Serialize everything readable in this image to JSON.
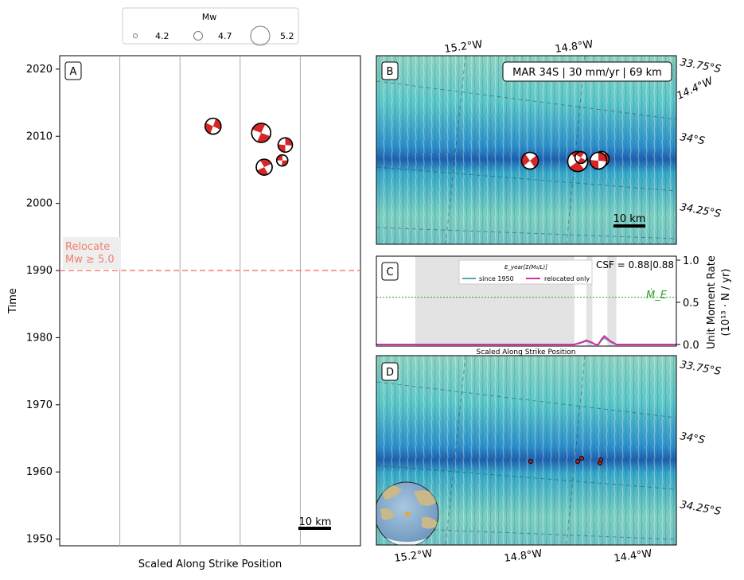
{
  "legend": {
    "title": "Mw",
    "entries": [
      {
        "label": "4.2",
        "value": 4.2
      },
      {
        "label": "4.7",
        "value": 4.7
      },
      {
        "label": "5.2",
        "value": 5.2
      }
    ]
  },
  "panelA": {
    "tag": "A",
    "xlabel": "Scaled Along Strike Position",
    "ylabel": "Time",
    "yticks": [
      "1950",
      "1960",
      "1970",
      "1980",
      "1990",
      "2000",
      "2010",
      "2020"
    ],
    "relocate_label": "Relocate",
    "relocate_mw": "Mw ≥ 5.0",
    "scalebar": "10 km"
  },
  "panelB": {
    "tag": "B",
    "info": "MAR 34S | 30 mm/yr | 69 km",
    "top_lon_labels": [
      "15.2°W",
      "14.8°W"
    ],
    "right_labels": [
      "33.75°S",
      "14.4°W",
      "34°S",
      "34.25°S"
    ],
    "scalebar": "10 km"
  },
  "panelC": {
    "tag": "C",
    "csf": "CSF = 0.88|0.88",
    "legend_title": "E_year[Σ(M₀/L)]",
    "series": [
      "since 1950",
      "relocated only"
    ],
    "xlabel": "Scaled Along Strike Position",
    "ylabel": "Unit Moment Rate",
    "ylabel_units": "(10¹³ · N / yr)",
    "yticks": [
      "0.0",
      "0.5",
      "1.0"
    ],
    "me_label": "Ṁ_E"
  },
  "panelD": {
    "tag": "D",
    "right_labels": [
      "33.75°S",
      "34°S",
      "34.25°S"
    ],
    "bottom_lon_labels": [
      "15.2°W",
      "14.8°W",
      "14.4°W"
    ]
  },
  "chart_data": [
    {
      "type": "scatter",
      "panel": "A",
      "xlabel": "Scaled Along Strike Position",
      "ylabel": "Time",
      "ylim": [
        1949,
        2022
      ],
      "xlim": [
        0,
        1
      ],
      "relocate_threshold_year": 1990,
      "events": [
        {
          "x": 0.51,
          "year": 2011.5,
          "mw": 4.9
        },
        {
          "x": 0.67,
          "year": 2010.5,
          "mw": 5.1
        },
        {
          "x": 0.75,
          "year": 2008.7,
          "mw": 4.8
        },
        {
          "x": 0.74,
          "year": 2006.4,
          "mw": 4.6
        },
        {
          "x": 0.68,
          "year": 2005.4,
          "mw": 4.9
        }
      ]
    },
    {
      "type": "line",
      "panel": "C",
      "xlabel": "Scaled Along Strike Position",
      "ylabel": "Unit Moment Rate",
      "ylim": [
        0,
        1.0
      ],
      "xlim": [
        0,
        1
      ],
      "me_level": 0.56,
      "series": [
        {
          "name": "since 1950",
          "color": "#5fa8a8",
          "x": [
            0,
            0.66,
            0.68,
            0.7,
            0.72,
            0.73,
            0.74,
            0.75,
            0.76,
            0.78,
            0.8,
            1.0
          ],
          "y": [
            0,
            0,
            0.02,
            0.04,
            0.02,
            0,
            0,
            0.05,
            0.08,
            0.03,
            0,
            0
          ]
        },
        {
          "name": "relocated only",
          "color": "#d62fa5",
          "x": [
            0,
            0.66,
            0.68,
            0.7,
            0.72,
            0.73,
            0.74,
            0.75,
            0.76,
            0.78,
            0.8,
            1.0
          ],
          "y": [
            0,
            0,
            0.02,
            0.05,
            0.02,
            0,
            0,
            0.06,
            0.1,
            0.04,
            0,
            0
          ]
        }
      ],
      "shaded_bands": [
        [
          0.13,
          0.66
        ],
        [
          0.7,
          0.72
        ],
        [
          0.77,
          0.8
        ]
      ]
    }
  ],
  "colors": {
    "beachball_fill": "#d62728",
    "relocate_line": "#f08070",
    "me_line": "#2ca02c",
    "map_deep": "#1e5fae",
    "map_mid": "#29b6c8",
    "map_shallow": "#b8e6c4"
  }
}
